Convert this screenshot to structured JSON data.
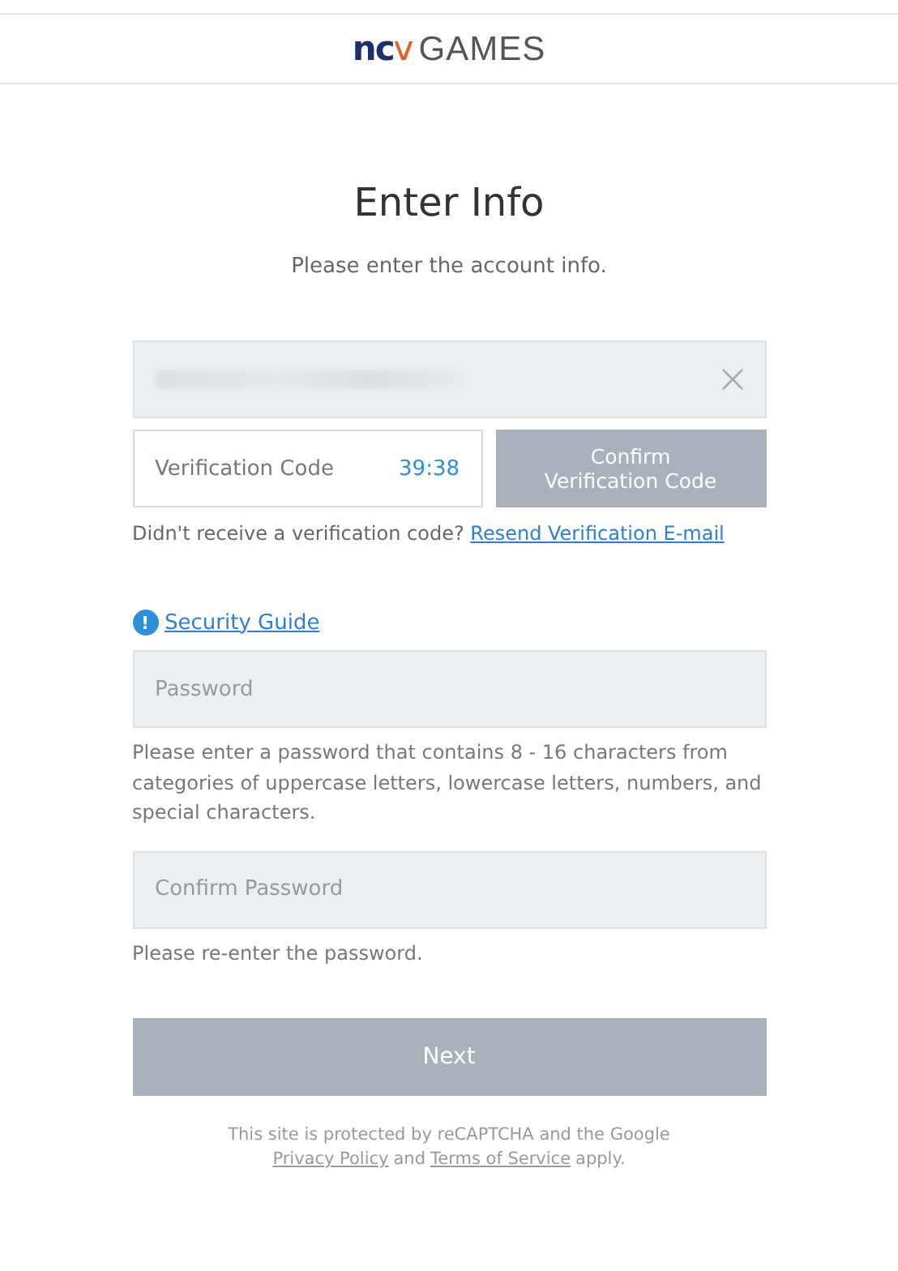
{
  "header": {
    "logo": {
      "mark": "nc",
      "accent": "v",
      "text": "GAMES"
    }
  },
  "title": "Enter Info",
  "subtitle": "Please enter the account info.",
  "email_field": {
    "redacted": true
  },
  "verification": {
    "placeholder": "Verification Code",
    "timer": "39:38",
    "confirm_button": {
      "label_lines": [
        "Confirm",
        "Verification Code"
      ],
      "disabled": true
    }
  },
  "resend": {
    "text": "Didn't receive a verification code?",
    "link": "Resend Verification E-mail"
  },
  "security_guide": {
    "icon": "!",
    "link": "Security Guide"
  },
  "password": {
    "placeholder": "Password",
    "hint": "Please enter a password that contains 8 - 16 characters from categories of uppercase letters, lowercase letters, numbers, and special characters."
  },
  "confirm_password": {
    "placeholder": "Confirm Password",
    "hint": "Please re-enter the password."
  },
  "next_button": {
    "label": "Next",
    "disabled": true
  },
  "footer": {
    "line1": "This site is protected by reCAPTCHA and the Google",
    "privacy": "Privacy Policy",
    "and": "and",
    "terms": "Terms of Service",
    "apply": "apply."
  }
}
